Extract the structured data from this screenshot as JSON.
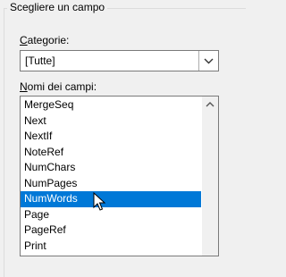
{
  "group": {
    "title": "Scegliere un campo"
  },
  "categories": {
    "label_prefix": "",
    "label_mnemonic": "C",
    "label_rest": "ategorie:",
    "selected_value": "[Tutte]"
  },
  "fields": {
    "label_mnemonic": "N",
    "label_rest": "omi dei campi:",
    "items": [
      "MergeSeq",
      "Next",
      "NextIf",
      "NoteRef",
      "NumChars",
      "NumPages",
      "NumWords",
      "Page",
      "PageRef",
      "Print"
    ],
    "selected_index": 6
  },
  "colors": {
    "selection": "#0078d7",
    "background": "#f0f0f0"
  }
}
